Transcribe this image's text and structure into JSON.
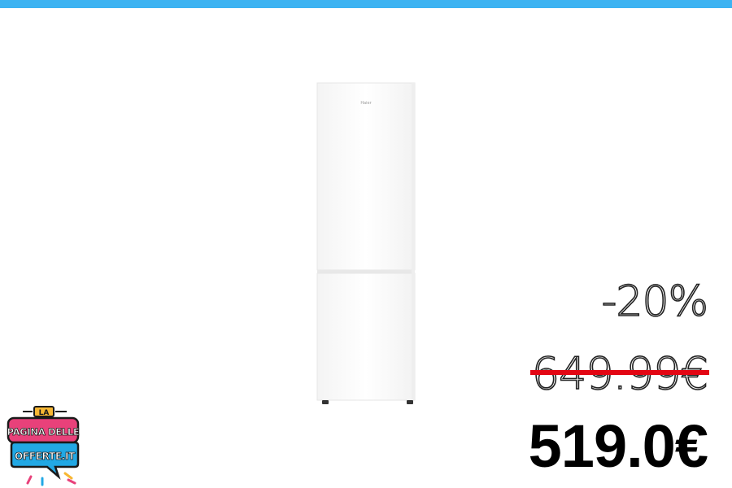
{
  "header": {
    "accent_color": "#3db3f2"
  },
  "product": {
    "image_icon": "fridge-icon",
    "brand_mark": "Haier"
  },
  "pricing": {
    "discount": "-20%",
    "old_price": "649.99€",
    "new_price": "519.0€",
    "strike_color": "#e30613"
  },
  "logo": {
    "line1": "LA",
    "line2": "PAGINA DELLE",
    "line3": "OFFERTE.IT"
  }
}
